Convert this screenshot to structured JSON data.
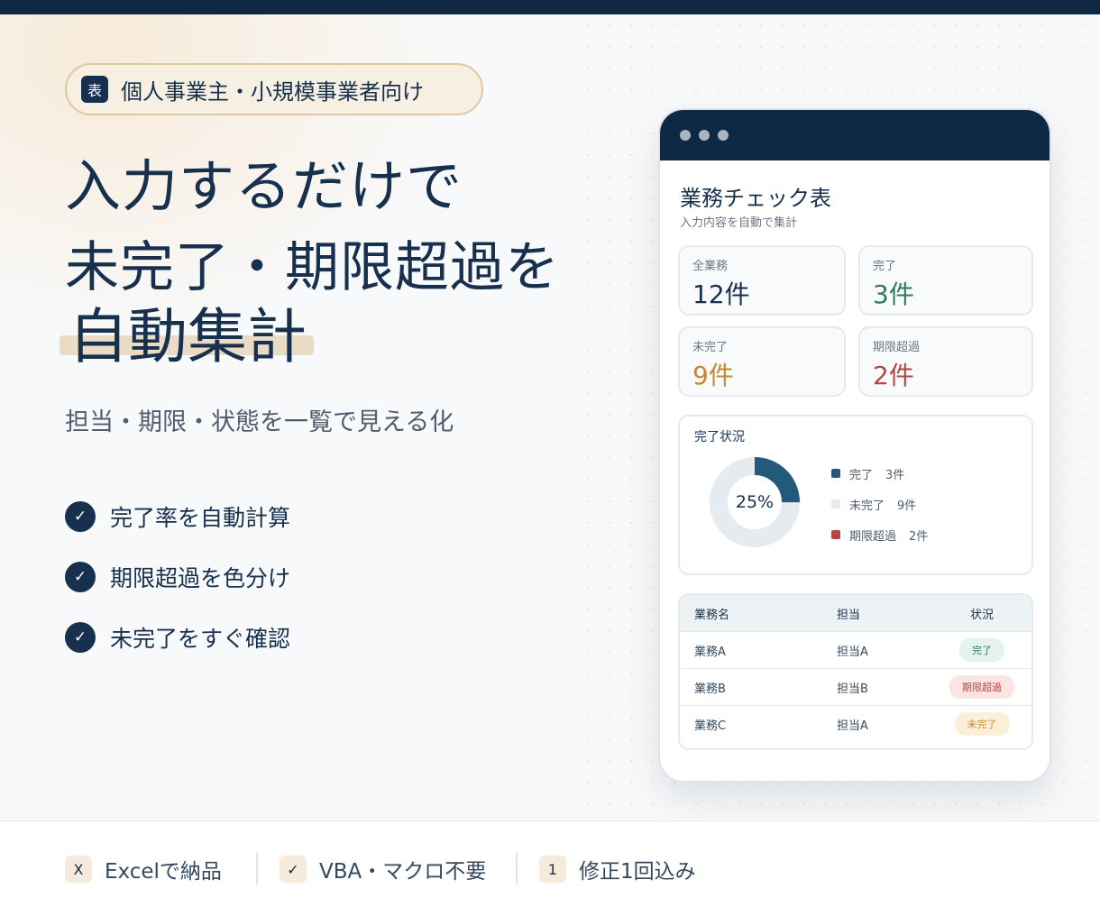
{
  "badge": {
    "icon": "表",
    "text": "個人事業主・小規模事業者向け"
  },
  "headline": {
    "line1": "入力するだけで",
    "line2": "未完了・期限超過を",
    "line3": "自動集計"
  },
  "subtitle": "担当・期限・状態を一覧で見える化",
  "features": [
    {
      "icon": "check-icon",
      "glyph": "✓",
      "label": "完了率を自動計算"
    },
    {
      "icon": "check-icon",
      "glyph": "✓",
      "label": "期限超過を色分け"
    },
    {
      "icon": "check-icon",
      "glyph": "✓",
      "label": "未完了をすぐ確認"
    }
  ],
  "sheet": {
    "title": "業務チェック表",
    "subtitle": "入力内容を自動で集計",
    "kpis": [
      {
        "label": "全業務",
        "value": "12件",
        "color": "#16304d"
      },
      {
        "label": "完了",
        "value": "3件",
        "color": "#2f7a5f"
      },
      {
        "label": "未完了",
        "value": "9件",
        "color": "#c48a2c"
      },
      {
        "label": "期限超過",
        "value": "2件",
        "color": "#b5473f"
      }
    ],
    "chart_title": "完了状況",
    "donut_center": "25%",
    "legend": [
      {
        "label": "完了",
        "count": "3件",
        "color": "#23597a"
      },
      {
        "label": "未完了",
        "count": "9件",
        "color": "#e6ebef"
      },
      {
        "label": "期限超過",
        "count": "2件",
        "color": "#b5473f"
      }
    ],
    "table": {
      "headers": [
        "業務名",
        "担当",
        "状況"
      ],
      "rows": [
        {
          "name": "業務A",
          "owner": "担当A",
          "status": "完了",
          "bg": "#e6f2ec",
          "fg": "#2f7a5f"
        },
        {
          "name": "業務B",
          "owner": "担当B",
          "status": "期限超過",
          "bg": "#fbe4e2",
          "fg": "#b5473f"
        },
        {
          "name": "業務C",
          "owner": "担当A",
          "status": "未完了",
          "bg": "#fcefd8",
          "fg": "#c48a2c"
        }
      ]
    }
  },
  "chart_data": {
    "type": "pie",
    "categories": [
      "完了",
      "未完了"
    ],
    "values": [
      3,
      9
    ],
    "title": "完了状況"
  },
  "footer": [
    {
      "icon": "excel-icon",
      "glyph": "X",
      "label": "Excelで納品"
    },
    {
      "icon": "check-icon",
      "glyph": "✓",
      "label": "VBA・マクロ不要"
    },
    {
      "icon": "number-one-icon",
      "glyph": "1",
      "label": "修正1回込み"
    }
  ],
  "colors": {
    "navy": "#0f2944",
    "accent": "#eadcc4"
  }
}
